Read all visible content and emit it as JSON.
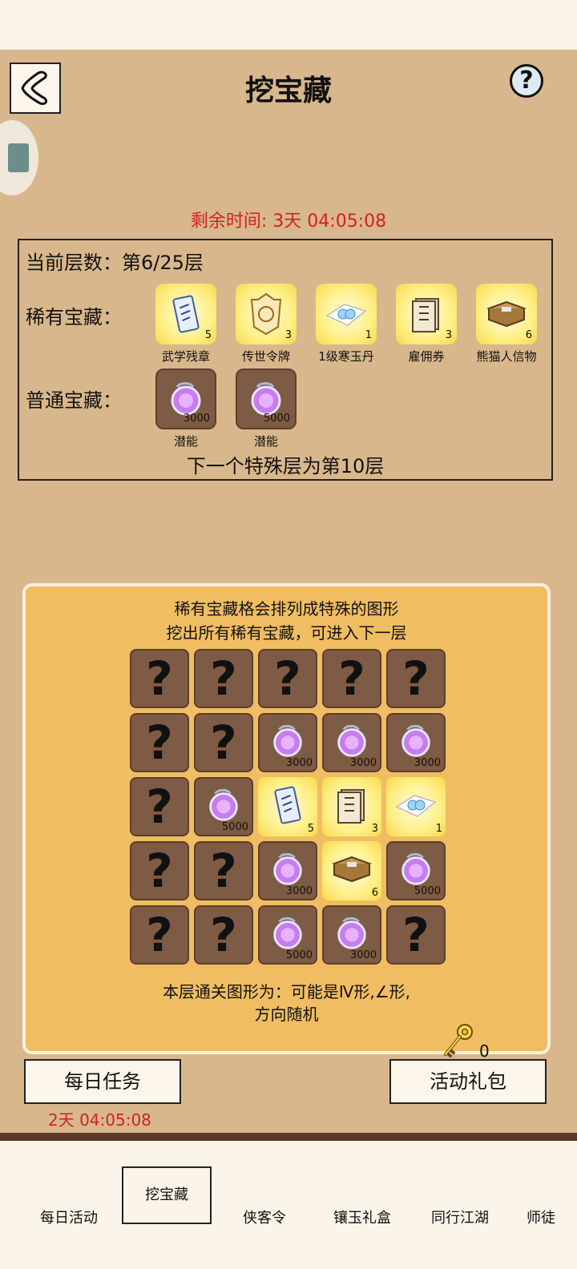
{
  "header": {
    "title": "挖宝藏"
  },
  "countdown": "剩余时间: 3天 04:05:08",
  "info": {
    "floor": "当前层数：第6/25层",
    "rare_label": "稀有宝藏：",
    "rare_items": [
      {
        "name": "武学残章",
        "count": "5",
        "icon": "scroll-icon"
      },
      {
        "name": "传世令牌",
        "count": "3",
        "icon": "token-icon"
      },
      {
        "name": "1级寒玉丹",
        "count": "1",
        "icon": "pill-icon"
      },
      {
        "name": "雇佣券",
        "count": "3",
        "icon": "ticket-icon"
      },
      {
        "name": "熊猫人信物",
        "count": "6",
        "icon": "chest-icon"
      }
    ],
    "common_label": "普通宝藏：",
    "common_items": [
      {
        "name": "潜能",
        "count": "3000",
        "icon": "potential-orb-icon"
      },
      {
        "name": "潜能",
        "count": "5000",
        "icon": "potential-orb-icon"
      }
    ],
    "next_special": "下一个特殊层为第10层"
  },
  "dig": {
    "hint_line1": "稀有宝藏格会排列成特殊的图形",
    "hint_line2": "挖出所有稀有宝藏，可进入下一层",
    "grid": [
      [
        {
          "type": "unknown",
          "count": ""
        },
        {
          "type": "unknown",
          "count": ""
        },
        {
          "type": "unknown",
          "count": ""
        },
        {
          "type": "unknown",
          "count": ""
        },
        {
          "type": "unknown",
          "count": ""
        }
      ],
      [
        {
          "type": "unknown",
          "count": ""
        },
        {
          "type": "unknown",
          "count": ""
        },
        {
          "type": "potential",
          "count": "3000"
        },
        {
          "type": "potential",
          "count": "3000"
        },
        {
          "type": "potential",
          "count": "3000"
        }
      ],
      [
        {
          "type": "unknown",
          "count": ""
        },
        {
          "type": "potential",
          "count": "5000"
        },
        {
          "type": "scroll",
          "count": "5"
        },
        {
          "type": "ticket",
          "count": "3"
        },
        {
          "type": "pill",
          "count": "1"
        }
      ],
      [
        {
          "type": "unknown",
          "count": ""
        },
        {
          "type": "unknown",
          "count": ""
        },
        {
          "type": "potential",
          "count": "3000"
        },
        {
          "type": "chest",
          "count": "6"
        },
        {
          "type": "potential",
          "count": "5000"
        }
      ],
      [
        {
          "type": "unknown",
          "count": ""
        },
        {
          "type": "unknown",
          "count": ""
        },
        {
          "type": "potential",
          "count": "5000"
        },
        {
          "type": "potential",
          "count": "3000"
        },
        {
          "type": "unknown",
          "count": ""
        }
      ]
    ],
    "pattern_line1": "本层通关图形为：可能是Ⅳ形,∠形,",
    "pattern_line2": "方向随机",
    "key_count": "0",
    "unknown_glyph": "?"
  },
  "buttons": {
    "daily_tasks": "每日任务",
    "gift_pack": "活动礼包"
  },
  "daily_timer": "2天 04:05:08",
  "help_glyph": "?",
  "tabs": [
    {
      "label": "每日活动",
      "active": false
    },
    {
      "label": "挖宝藏",
      "active": true
    },
    {
      "label": "侠客令",
      "active": false
    },
    {
      "label": "镶玉礼盒",
      "active": false
    },
    {
      "label": "同行江湖",
      "active": false
    },
    {
      "label": "师徒",
      "active": false
    }
  ],
  "colors": {
    "background": "#d8b78c",
    "panel": "#f0bd63",
    "timer_red": "#d61f1f",
    "cell_brown": "#7e5b44"
  }
}
